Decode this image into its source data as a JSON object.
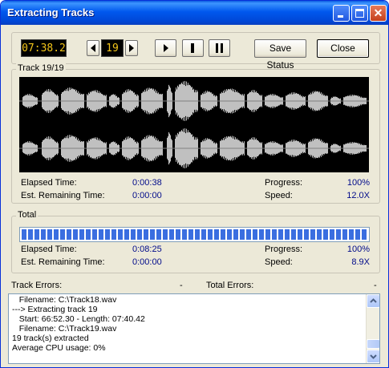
{
  "window": {
    "title": "Extracting Tracks"
  },
  "toolbar": {
    "time_display": "07:38.2",
    "track_number": "19",
    "prev_icon": "triangle-left-icon",
    "next_icon": "triangle-right-icon",
    "play_icon": "play-icon",
    "stop_icon": "stop-icon",
    "pause_icon": "pause-icon",
    "save_status_label": "Save Status",
    "close_label": "Close"
  },
  "track": {
    "group_label": "Track 19/19",
    "elapsed_label": "Elapsed Time:",
    "elapsed_value": "0:00:38",
    "remaining_label": "Est. Remaining Time:",
    "remaining_value": "0:00:00",
    "progress_label": "Progress:",
    "progress_value": "100%",
    "speed_label": "Speed:",
    "speed_value": "12.0X"
  },
  "total": {
    "group_label": "Total",
    "progress_fraction": 1.0,
    "elapsed_label": "Elapsed Time:",
    "elapsed_value": "0:08:25",
    "remaining_label": "Est. Remaining Time:",
    "remaining_value": "0:00:00",
    "progress_label": "Progress:",
    "progress_value": "100%",
    "speed_label": "Speed:",
    "speed_value": "8.9X"
  },
  "errors": {
    "track_errors_label": "Track Errors:",
    "track_errors_value": "-",
    "total_errors_label": "Total Errors:",
    "total_errors_value": "-"
  },
  "log": {
    "lines": [
      "   Filename: C:\\Track18.wav",
      "---> Extracting track 19",
      "   Start: 66:52.30 - Length: 07:40.42",
      "   Filename: C:\\Track19.wav",
      "19 track(s) extracted",
      "Average CPU usage: 0%"
    ]
  },
  "colors": {
    "lcd_text": "#f2c41a",
    "value_text": "#000a8a",
    "progress_blue": "#3a6ee0",
    "waveform": "#c0c0c0"
  }
}
